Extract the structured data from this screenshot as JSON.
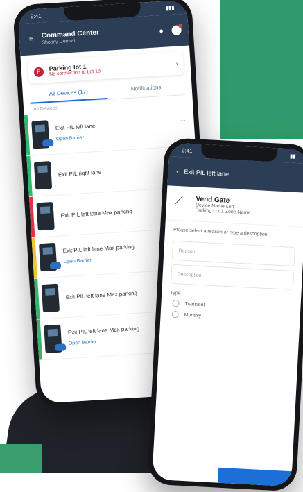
{
  "phone_a": {
    "status_time": "9:41",
    "app_title": "Command Center",
    "app_subtitle": "Shopify Central",
    "parking_lot": {
      "name": "Parking lot 1",
      "warning": "No connection to Lot 18"
    },
    "tabs": [
      {
        "label": "All Devices (17)"
      },
      {
        "label": "Notifications"
      }
    ],
    "filter_label": "All Devices",
    "rows": [
      {
        "label": "Exit PIL left lane",
        "link": "Open Barrier",
        "stripe": "#35b66d"
      },
      {
        "label": "Exit PIL right lane",
        "link": "",
        "stripe": "#35b66d"
      },
      {
        "label": "Exit PIL left lane Max parking",
        "link": "",
        "stripe": "#df3347"
      },
      {
        "label": "Exit PIL left lane Max parking",
        "link": "Open Barrier",
        "stripe": "#f0c531"
      },
      {
        "label": "Exit PIL left lane Max parking",
        "link": "",
        "stripe": "#35b66d"
      },
      {
        "label": "Exit PIL left lane Max parking",
        "link": "Open Barrier",
        "stripe": "#35b66d"
      }
    ]
  },
  "phone_b": {
    "status_time": "9:41",
    "back_title": "Exit PIL left lane",
    "gate": {
      "title": "Vend Gate",
      "line1": "Device Name Left",
      "line2": "Parking Lot 1 Zone Name"
    },
    "prompt": "Please select a reason or type a description",
    "field_reason": "Reason",
    "field_description": "Description",
    "type_label": "Type",
    "types": [
      {
        "label": "Transient"
      },
      {
        "label": "Monthly"
      }
    ]
  }
}
